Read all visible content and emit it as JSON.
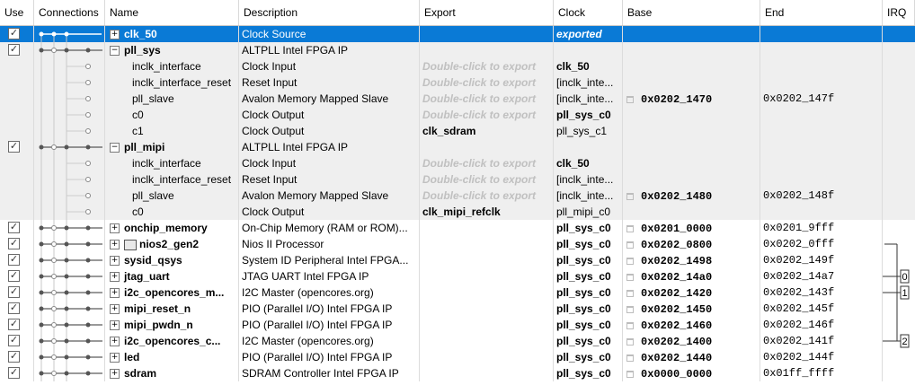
{
  "headers": [
    "Use",
    "Connections",
    "Name",
    "Description",
    "Export",
    "Clock",
    "Base",
    "End",
    "IRQ"
  ],
  "rows": [
    {
      "use": true,
      "exp": "+",
      "name": "clk_50",
      "desc": "Clock Source",
      "export": "",
      "clock": "exported",
      "base": "",
      "end": "",
      "level": 0,
      "selected": true
    },
    {
      "use": true,
      "exp": "−",
      "name": "pll_sys",
      "desc": "ALTPLL Intel FPGA IP",
      "export": "",
      "clock": "",
      "base": "",
      "end": "",
      "level": 0,
      "shade": true
    },
    {
      "use": null,
      "exp": "",
      "name": "inclk_interface",
      "desc": "Clock Input",
      "export": "Double-click to export",
      "clock": "clk_50",
      "base": "",
      "end": "",
      "level": 1,
      "shade": true
    },
    {
      "use": null,
      "exp": "",
      "name": "inclk_interface_reset",
      "desc": "Reset Input",
      "export": "Double-click to export",
      "clock": "[inclk_inte...",
      "base": "",
      "end": "",
      "level": 1,
      "shade": true
    },
    {
      "use": null,
      "exp": "",
      "name": "pll_slave",
      "desc": "Avalon Memory Mapped Slave",
      "export": "Double-click to export",
      "clock": "[inclk_inte...",
      "base": "0x0202_1470",
      "end": "0x0202_147f",
      "level": 1,
      "shade": true
    },
    {
      "use": null,
      "exp": "",
      "name": "c0",
      "desc": "Clock Output",
      "export": "Double-click to export",
      "clock": "pll_sys_c0",
      "base": "",
      "end": "",
      "level": 1,
      "shade": true
    },
    {
      "use": null,
      "exp": "",
      "name": "c1",
      "desc": "Clock Output",
      "export": "clk_sdram",
      "clock": "pll_sys_c1",
      "base": "",
      "end": "",
      "level": 1,
      "shade": true
    },
    {
      "use": true,
      "exp": "−",
      "name": "pll_mipi",
      "desc": "ALTPLL Intel FPGA IP",
      "export": "",
      "clock": "",
      "base": "",
      "end": "",
      "level": 0,
      "shade": true
    },
    {
      "use": null,
      "exp": "",
      "name": "inclk_interface",
      "desc": "Clock Input",
      "export": "Double-click to export",
      "clock": "clk_50",
      "base": "",
      "end": "",
      "level": 1,
      "shade": true
    },
    {
      "use": null,
      "exp": "",
      "name": "inclk_interface_reset",
      "desc": "Reset Input",
      "export": "Double-click to export",
      "clock": "[inclk_inte...",
      "base": "",
      "end": "",
      "level": 1,
      "shade": true
    },
    {
      "use": null,
      "exp": "",
      "name": "pll_slave",
      "desc": "Avalon Memory Mapped Slave",
      "export": "Double-click to export",
      "clock": "[inclk_inte...",
      "base": "0x0202_1480",
      "end": "0x0202_148f",
      "level": 1,
      "shade": true
    },
    {
      "use": null,
      "exp": "",
      "name": "c0",
      "desc": "Clock Output",
      "export": "clk_mipi_refclk",
      "clock": "pll_mipi_c0",
      "base": "",
      "end": "",
      "level": 1,
      "shade": true
    },
    {
      "use": true,
      "exp": "+",
      "name": "onchip_memory",
      "desc": "On-Chip Memory (RAM or ROM)...",
      "export": "",
      "clock": "pll_sys_c0",
      "base": "0x0201_0000",
      "end": "0x0201_9fff",
      "level": 0
    },
    {
      "use": true,
      "exp": "+",
      "name": "nios2_gen2",
      "desc": "Nios II Processor",
      "export": "",
      "clock": "pll_sys_c0",
      "base": "0x0202_0800",
      "end": "0x0202_0fff",
      "level": 0,
      "chip": true,
      "irqrow": "arrow"
    },
    {
      "use": true,
      "exp": "+",
      "name": "sysid_qsys",
      "desc": "System ID Peripheral Intel FPGA...",
      "export": "",
      "clock": "pll_sys_c0",
      "base": "0x0202_1498",
      "end": "0x0202_149f",
      "level": 0
    },
    {
      "use": true,
      "exp": "+",
      "name": "jtag_uart",
      "desc": "JTAG UART Intel FPGA IP",
      "export": "",
      "clock": "pll_sys_c0",
      "base": "0x0202_14a0",
      "end": "0x0202_14a7",
      "level": 0,
      "irq": "0"
    },
    {
      "use": true,
      "exp": "+",
      "name": "i2c_opencores_m...",
      "desc": "I2C Master (opencores.org)",
      "export": "",
      "clock": "pll_sys_c0",
      "base": "0x0202_1420",
      "end": "0x0202_143f",
      "level": 0,
      "irq": "1"
    },
    {
      "use": true,
      "exp": "+",
      "name": "mipi_reset_n",
      "desc": "PIO (Parallel I/O) Intel FPGA IP",
      "export": "",
      "clock": "pll_sys_c0",
      "base": "0x0202_1450",
      "end": "0x0202_145f",
      "level": 0
    },
    {
      "use": true,
      "exp": "+",
      "name": "mipi_pwdn_n",
      "desc": "PIO (Parallel I/O) Intel FPGA IP",
      "export": "",
      "clock": "pll_sys_c0",
      "base": "0x0202_1460",
      "end": "0x0202_146f",
      "level": 0
    },
    {
      "use": true,
      "exp": "+",
      "name": "i2c_opencores_c...",
      "desc": "I2C Master (opencores.org)",
      "export": "",
      "clock": "pll_sys_c0",
      "base": "0x0202_1400",
      "end": "0x0202_141f",
      "level": 0,
      "irq": "2"
    },
    {
      "use": true,
      "exp": "+",
      "name": "led",
      "desc": "PIO (Parallel I/O) Intel FPGA IP",
      "export": "",
      "clock": "pll_sys_c0",
      "base": "0x0202_1440",
      "end": "0x0202_144f",
      "level": 0
    },
    {
      "use": true,
      "exp": "+",
      "name": "sdram",
      "desc": "SDRAM Controller Intel FPGA IP",
      "export": "",
      "clock": "pll_sys_c0",
      "base": "0x0000_0000",
      "end": "0x01ff_ffff",
      "level": 0
    }
  ],
  "colors": {
    "selection": "#0a7ad6",
    "shade": "#efefef",
    "hint": "#c0c0c0"
  }
}
